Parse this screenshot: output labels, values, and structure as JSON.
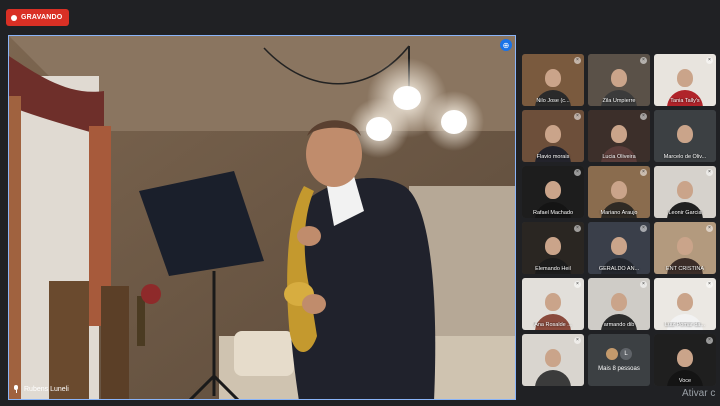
{
  "recording": {
    "label": "GRAVANDO"
  },
  "main_video": {
    "speaker_name": "Rubens Luneli",
    "pin_icon": "pin-icon"
  },
  "participants": [
    {
      "name": "Nilo Jose (c...",
      "bg": "#7a5a3e",
      "body": "#2a2a2a",
      "muted": true
    },
    {
      "name": "Zila Umpierre",
      "bg": "#5a5148",
      "body": "#3b3b3b",
      "muted": true
    },
    {
      "name": "Tania Tally's",
      "bg": "#e8e4de",
      "body": "#b0242a",
      "muted": true
    },
    {
      "name": "Flavio morais",
      "bg": "#6d4f3a",
      "body": "#23232b",
      "muted": true
    },
    {
      "name": "Lucia Oliveira",
      "bg": "#3c2f2a",
      "body": "#5b3d3a",
      "muted": true
    },
    {
      "name": "Marcelo de Oliv...",
      "bg": "#3c4043",
      "body": "#3c4043",
      "muted": false
    },
    {
      "name": "Rafael Machado",
      "bg": "#1d1d1d",
      "body": "#141414",
      "muted": true
    },
    {
      "name": "Mariano Araujo",
      "bg": "#8a6c4e",
      "body": "#2f2a24",
      "muted": true
    },
    {
      "name": "Leonir Garcia",
      "bg": "#d6d2cc",
      "body": "#202020",
      "muted": true
    },
    {
      "name": "Elemando Heil",
      "bg": "#2a2622",
      "body": "#1c1c1c",
      "muted": true
    },
    {
      "name": "GERALDO AN...",
      "bg": "#3a3f4a",
      "body": "#23262d",
      "muted": true
    },
    {
      "name": "ENT CRISTINA",
      "bg": "#b39a7e",
      "body": "#3b2d28",
      "muted": true
    },
    {
      "name": "Ana Rosalde ...",
      "bg": "#e2dfda",
      "body": "#8a4a3c",
      "muted": true
    },
    {
      "name": "armando dib",
      "bg": "#cfccc7",
      "body": "#2c2c2c",
      "muted": true
    },
    {
      "name": "Luiz Pomar da...",
      "bg": "#ebe8e3",
      "body": "#f2f2f2",
      "muted": true
    },
    {
      "name": "",
      "bg": "#d9d5cf",
      "body": "#3b3b3b",
      "muted": true
    },
    {
      "name": "Voce",
      "bg": "#1f1f1f",
      "body": "#141414",
      "muted": true
    }
  ],
  "more_people": {
    "label": "Mais 8 pessoas",
    "avatars": [
      {
        "letter": "",
        "color": "#c49a6c"
      },
      {
        "letter": "L",
        "color": "#5f6368"
      }
    ]
  },
  "footer": {
    "activate_text": "Ativar c"
  },
  "colors": {
    "recording": "#d93025",
    "active_border": "#8ab4f8",
    "background": "#202124"
  }
}
